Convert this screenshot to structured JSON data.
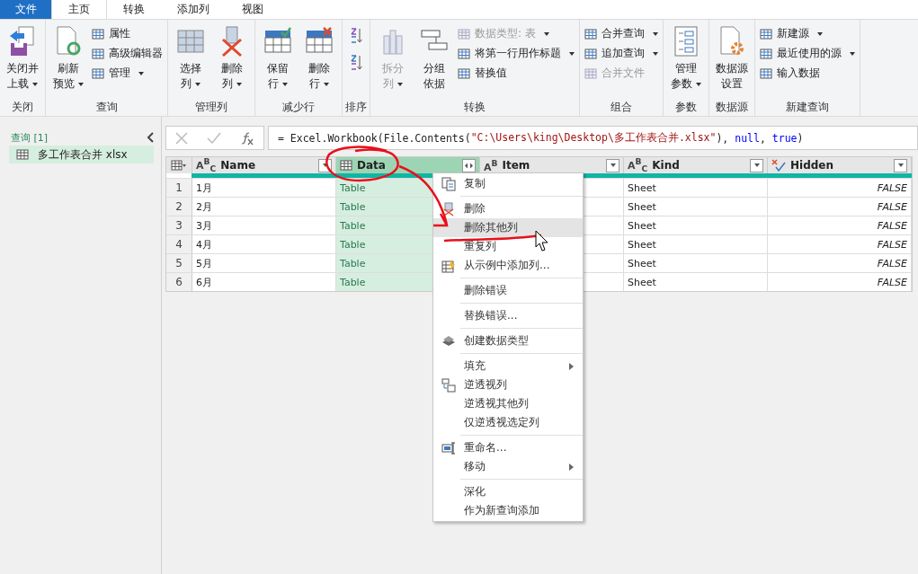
{
  "ribbon_tabs": [
    {
      "label": "文件",
      "kind": "file",
      "selected": false
    },
    {
      "label": "主页",
      "kind": "tab",
      "selected": true
    },
    {
      "label": "转换",
      "kind": "tab",
      "selected": false
    },
    {
      "label": "添加列",
      "kind": "tab",
      "selected": false
    },
    {
      "label": "视图",
      "kind": "tab",
      "selected": false
    }
  ],
  "ribbon_groups": [
    {
      "label": "关闭",
      "items": [
        {
          "kind": "large",
          "label": [
            "关闭并",
            "上载"
          ],
          "dropdown": true,
          "disabled": false
        }
      ]
    },
    {
      "label": "查询",
      "items": [
        {
          "kind": "large",
          "label": [
            "刷新",
            "预览"
          ],
          "dropdown": true,
          "disabled": false
        },
        {
          "kind": "stack",
          "items": [
            {
              "label": "属性",
              "dropdown": false,
              "disabled": false
            },
            {
              "label": "高级编辑器",
              "dropdown": false,
              "disabled": false
            },
            {
              "label": "管理",
              "dropdown": true,
              "disabled": false
            }
          ]
        }
      ]
    },
    {
      "label": "管理列",
      "items": [
        {
          "kind": "large",
          "label": [
            "选择",
            "列"
          ],
          "dropdown": true,
          "disabled": false
        },
        {
          "kind": "large",
          "label": [
            "删除",
            "列"
          ],
          "dropdown": true,
          "disabled": false
        }
      ]
    },
    {
      "label": "减少行",
      "items": [
        {
          "kind": "large",
          "label": [
            "保留",
            "行"
          ],
          "dropdown": true,
          "disabled": false
        },
        {
          "kind": "large",
          "label": [
            "删除",
            "行"
          ],
          "dropdown": true,
          "disabled": false
        }
      ]
    },
    {
      "label": "排序",
      "items": [
        {
          "kind": "sort"
        }
      ]
    },
    {
      "label": "转换",
      "items": [
        {
          "kind": "large",
          "label": [
            "拆分",
            "列"
          ],
          "dropdown": true,
          "disabled": true
        },
        {
          "kind": "large",
          "label": [
            "分组",
            "依据"
          ],
          "dropdown": false,
          "disabled": false
        },
        {
          "kind": "stack",
          "items": [
            {
              "label": "数据类型: 表",
              "dropdown": true,
              "disabled": true
            },
            {
              "label": "将第一行用作标题",
              "dropdown": true,
              "disabled": false
            },
            {
              "label": "替换值",
              "dropdown": false,
              "disabled": false
            }
          ]
        }
      ]
    },
    {
      "label": "组合",
      "items": [
        {
          "kind": "stack",
          "items": [
            {
              "label": "合并查询",
              "dropdown": true,
              "disabled": false
            },
            {
              "label": "追加查询",
              "dropdown": true,
              "disabled": false
            },
            {
              "label": "合并文件",
              "dropdown": false,
              "disabled": true
            }
          ]
        }
      ]
    },
    {
      "label": "参数",
      "items": [
        {
          "kind": "large",
          "label": [
            "管理",
            "参数"
          ],
          "dropdown": true,
          "disabled": false
        }
      ]
    },
    {
      "label": "数据源",
      "items": [
        {
          "kind": "large",
          "label": [
            "数据源",
            "设置"
          ],
          "dropdown": false,
          "disabled": false
        }
      ]
    },
    {
      "label": "新建查询",
      "items": [
        {
          "kind": "stack",
          "items": [
            {
              "label": "新建源",
              "dropdown": true,
              "disabled": false
            },
            {
              "label": "最近使用的源",
              "dropdown": true,
              "disabled": false
            },
            {
              "label": "输入数据",
              "dropdown": false,
              "disabled": false
            }
          ]
        }
      ]
    }
  ],
  "sidebar": {
    "title": "查询 [1]",
    "items": [
      {
        "label": "多工作表合并 xlsx",
        "selected": true
      }
    ]
  },
  "formula_bar": {
    "parts": [
      {
        "text": "= Excel.Workbook(File.Contents(",
        "kind": "code"
      },
      {
        "text": "\"C:\\Users\\king\\Desktop\\多工作表合并.xlsx\"",
        "kind": "string"
      },
      {
        "text": "), ",
        "kind": "code"
      },
      {
        "text": "null",
        "kind": "keyword"
      },
      {
        "text": ", ",
        "kind": "code"
      },
      {
        "text": "true",
        "kind": "keyword"
      },
      {
        "text": ")",
        "kind": "code"
      }
    ]
  },
  "table": {
    "columns": [
      {
        "name": "Name",
        "kind": "text",
        "type_label": "A$^{B}$$_{C}$",
        "selected": false
      },
      {
        "name": "Data",
        "kind": "table",
        "selected": true
      },
      {
        "name": "Item",
        "kind": "text",
        "type_label": "A$^{B}$",
        "selected": false
      },
      {
        "name": "Kind",
        "kind": "text",
        "type_label": "A$^{B}$$_{C}$",
        "selected": false
      },
      {
        "name": "Hidden",
        "kind": "logical",
        "selected": false
      }
    ],
    "rows": [
      {
        "index": "1",
        "cells": [
          "1月",
          "Table",
          "",
          "Sheet",
          "FALSE"
        ]
      },
      {
        "index": "2",
        "cells": [
          "2月",
          "Table",
          "",
          "Sheet",
          "FALSE"
        ]
      },
      {
        "index": "3",
        "cells": [
          "3月",
          "Table",
          "",
          "Sheet",
          "FALSE"
        ]
      },
      {
        "index": "4",
        "cells": [
          "4月",
          "Table",
          "",
          "Sheet",
          "FALSE"
        ]
      },
      {
        "index": "5",
        "cells": [
          "5月",
          "Table",
          "",
          "Sheet",
          "FALSE"
        ]
      },
      {
        "index": "6",
        "cells": [
          "6月",
          "Table",
          "",
          "Sheet",
          "FALSE"
        ]
      }
    ]
  },
  "context_menu": {
    "items": [
      {
        "label": "复制",
        "selected": false,
        "submenu": false,
        "separator_before": false
      },
      {
        "label": "删除",
        "selected": false,
        "submenu": false,
        "separator_before": true
      },
      {
        "label": "删除其他列",
        "selected": true,
        "submenu": false,
        "separator_before": false
      },
      {
        "label": "重复列",
        "selected": false,
        "submenu": false,
        "separator_before": false
      },
      {
        "label": "从示例中添加列...",
        "selected": false,
        "submenu": false,
        "separator_before": false
      },
      {
        "label": "删除错误",
        "selected": false,
        "submenu": false,
        "separator_before": true
      },
      {
        "label": "替换错误...",
        "selected": false,
        "submenu": false,
        "separator_before": true
      },
      {
        "label": "创建数据类型",
        "selected": false,
        "submenu": false,
        "separator_before": true
      },
      {
        "label": "填充",
        "selected": false,
        "submenu": true,
        "separator_before": true
      },
      {
        "label": "逆透视列",
        "selected": false,
        "submenu": false,
        "separator_before": false
      },
      {
        "label": "逆透视其他列",
        "selected": false,
        "submenu": false,
        "separator_before": false
      },
      {
        "label": "仅逆透视选定列",
        "selected": false,
        "submenu": false,
        "separator_before": false
      },
      {
        "label": "重命名...",
        "selected": false,
        "submenu": false,
        "separator_before": true
      },
      {
        "label": "移动",
        "selected": false,
        "submenu": true,
        "separator_before": false
      },
      {
        "label": "深化",
        "selected": false,
        "submenu": false,
        "separator_before": true
      },
      {
        "label": "作为新查询添加",
        "selected": false,
        "submenu": false,
        "separator_before": false
      }
    ]
  }
}
